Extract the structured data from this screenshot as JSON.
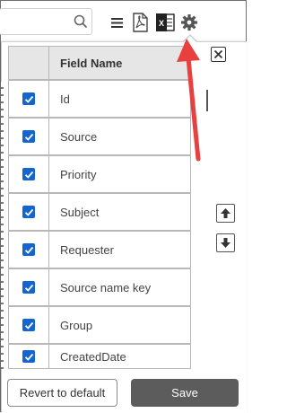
{
  "toolbar": {
    "search_placeholder": "",
    "icons": [
      "search-icon",
      "menu-icon",
      "pdf-export-icon",
      "excel-export-icon",
      "settings-gear-icon"
    ],
    "excel_letter": "X"
  },
  "field_chooser": {
    "header": "Field Name",
    "fields": [
      {
        "label": "Id",
        "checked": true
      },
      {
        "label": "Source",
        "checked": true
      },
      {
        "label": "Priority",
        "checked": true
      },
      {
        "label": "Subject",
        "checked": true
      },
      {
        "label": "Requester",
        "checked": true
      },
      {
        "label": "Source name key",
        "checked": true
      },
      {
        "label": "Group",
        "checked": true
      },
      {
        "label": "CreatedDate",
        "checked": true
      }
    ]
  },
  "footer": {
    "revert_label": "Revert to default",
    "save_label": "Save"
  },
  "colors": {
    "checkbox": "#1565d0",
    "save_button": "#5c5c5c",
    "annotation_arrow": "#e8403f",
    "header_bg": "#e6e6e6"
  }
}
